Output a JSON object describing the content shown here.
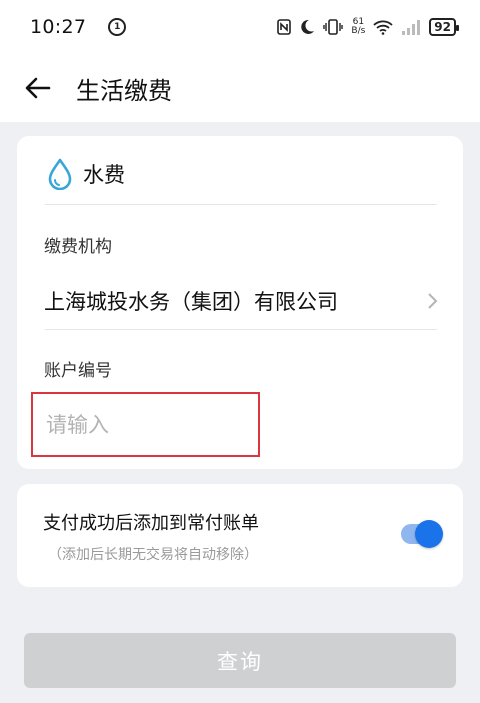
{
  "status_bar": {
    "time": "10:27",
    "notification_badge": "1",
    "network_speed_value": "61",
    "network_speed_unit": "B/s",
    "battery_level": "92"
  },
  "header": {
    "title": "生活缴费"
  },
  "utility": {
    "name": "水费",
    "icon": "water-drop-icon",
    "icon_color": "#3aa6d8"
  },
  "form": {
    "org_label": "缴费机构",
    "org_value": "上海城投水务（集团）有限公司",
    "account_label": "账户编号",
    "account_placeholder": "请输入",
    "account_value": ""
  },
  "autopay": {
    "title": "支付成功后添加到常付账单",
    "subtitle": "（添加后长期无交易将自动移除）",
    "enabled": true,
    "accent_color": "#1a73e8"
  },
  "actions": {
    "query_label": "查询"
  }
}
